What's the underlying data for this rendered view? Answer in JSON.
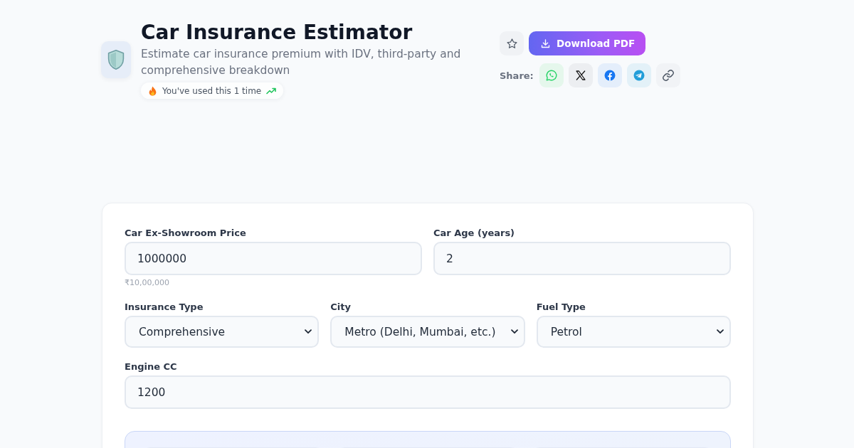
{
  "header": {
    "title": "Car Insurance Estimator",
    "subtitle": "Estimate car insurance premium with IDV, third-party and comprehensive breakdown",
    "usage_badge": "You've used this 1 time"
  },
  "actions": {
    "download_button": "Download PDF",
    "share_label": "Share:",
    "share_buttons": [
      {
        "kind": "whatsapp"
      },
      {
        "kind": "x"
      },
      {
        "kind": "facebook"
      },
      {
        "kind": "telegram"
      },
      {
        "kind": "link"
      }
    ]
  },
  "form": {
    "rows": [
      [
        {
          "kind": "input",
          "label": "Car Ex-Showroom Price",
          "value": "1000000",
          "hint": "₹10,00,000"
        },
        {
          "kind": "input",
          "label": "Car Age (years)",
          "value": "2"
        }
      ],
      [
        {
          "kind": "select",
          "label": "Insurance Type",
          "value": "Comprehensive"
        },
        {
          "kind": "select",
          "label": "City",
          "value": "Metro (Delhi, Mumbai, etc.)"
        },
        {
          "kind": "select",
          "label": "Fuel Type",
          "value": "Petrol"
        }
      ],
      [
        {
          "kind": "input",
          "label": "Engine CC",
          "value": "1200"
        }
      ]
    ]
  }
}
